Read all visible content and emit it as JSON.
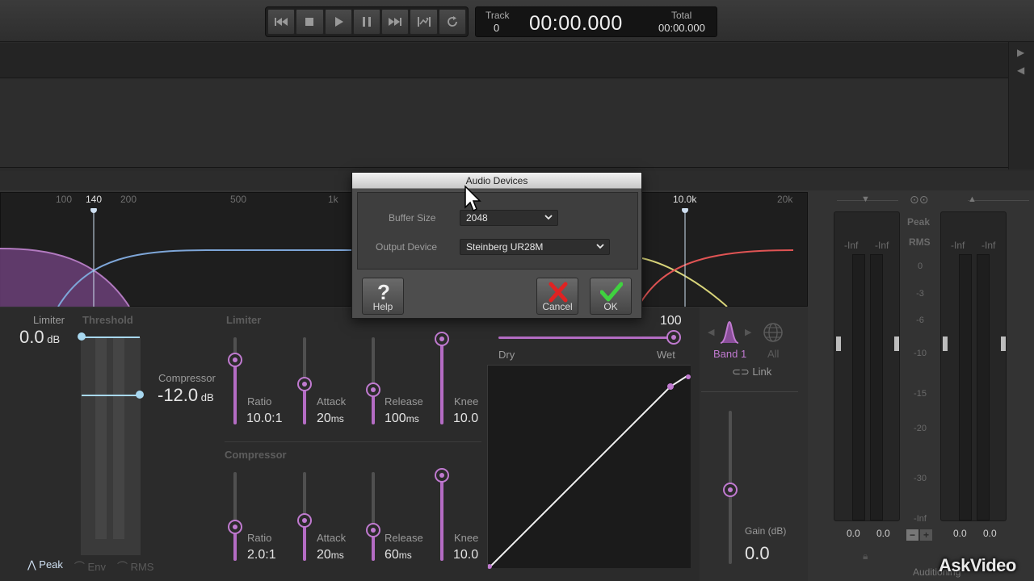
{
  "transport": {
    "buttons": [
      {
        "name": "rewind-icon"
      },
      {
        "name": "stop-icon"
      },
      {
        "name": "play-icon"
      },
      {
        "name": "pause-icon"
      },
      {
        "name": "forward-icon"
      },
      {
        "name": "loop-range-icon"
      },
      {
        "name": "loop-icon"
      }
    ],
    "track_label": "Track",
    "track_value": "0",
    "time": "00:00.000",
    "total_label": "Total",
    "total_value": "00:00.000"
  },
  "eq": {
    "freq_labels": [
      "100",
      "140",
      "200",
      "500",
      "1k",
      "10.0k",
      "20k"
    ],
    "colors": {
      "low_band": "#9b5fa8",
      "high_band_a": "#e05454",
      "high_band_b": "#d8d47a",
      "blue": "#7ea6d8"
    }
  },
  "dynamics": {
    "limiter_label": "Limiter",
    "limiter_value": "0.0",
    "limiter_unit": "dB",
    "threshold_label": "Threshold",
    "compressor_label": "Compressor",
    "compressor_value": "-12.0",
    "compressor_unit": "dB",
    "limiter_section": "Limiter",
    "compressor_section": "Compressor",
    "limiter_params": [
      {
        "label": "Ratio",
        "value": "10.0:1",
        "unit": ""
      },
      {
        "label": "Attack",
        "value": "20",
        "unit": "ms"
      },
      {
        "label": "Release",
        "value": "100",
        "unit": "ms"
      },
      {
        "label": "Knee",
        "value": "10.0",
        "unit": ""
      }
    ],
    "compressor_params": [
      {
        "label": "Ratio",
        "value": "2.0:1",
        "unit": ""
      },
      {
        "label": "Attack",
        "value": "20",
        "unit": "ms"
      },
      {
        "label": "Release",
        "value": "60",
        "unit": "ms"
      },
      {
        "label": "Knee",
        "value": "10.0",
        "unit": ""
      }
    ],
    "detect_modes": [
      "Peak",
      "Env",
      "RMS"
    ],
    "active_detect": "Peak"
  },
  "mix": {
    "value": "100",
    "dry_label": "Dry",
    "wet_label": "Wet"
  },
  "bands": {
    "band_label": "Band 1",
    "all_label": "All",
    "link_label": "Link",
    "gain_label": "Gain (dB)",
    "gain_value": "0.0"
  },
  "meters": {
    "peak_label": "Peak",
    "rms_label": "RMS",
    "inf_labels": [
      "-Inf",
      "-Inf",
      "-Inf",
      "-Inf"
    ],
    "scale": [
      "0",
      "-3",
      "-6",
      "-10",
      "-15",
      "-20",
      "-30",
      "-Inf"
    ],
    "values": [
      "0.0",
      "0.0",
      "0.0",
      "0.0"
    ],
    "auditioning_label": "Auditioning"
  },
  "dialog": {
    "title": "Audio Devices",
    "buffer_size_label": "Buffer Size",
    "buffer_size_value": "2048",
    "output_device_label": "Output Device",
    "output_device_value": "Steinberg UR28M",
    "help_label": "Help",
    "cancel_label": "Cancel",
    "ok_label": "OK"
  },
  "watermark": "AskVideo"
}
